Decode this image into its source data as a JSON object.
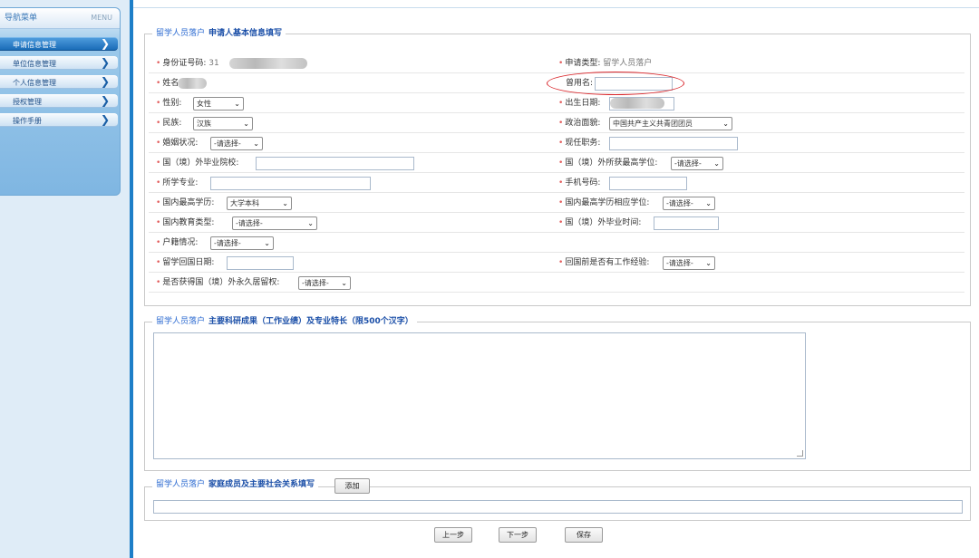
{
  "sidebar": {
    "title": "导航菜单",
    "menu_label": "MENU",
    "items": [
      {
        "label": "申请信息管理",
        "active": true
      },
      {
        "label": "单位信息管理",
        "active": false
      },
      {
        "label": "个人信息管理",
        "active": false
      },
      {
        "label": "授权管理",
        "active": false
      },
      {
        "label": "操作手册",
        "active": false
      }
    ]
  },
  "section1": {
    "lead": "留学人员落户",
    "title": "申请人基本信息填写"
  },
  "form": {
    "id_label": "身份证号码:",
    "id_value_prefix": "31",
    "apply_type_label": "申请类型:",
    "apply_type_value": "留学人员落户",
    "name_label": "姓名:",
    "former_name_label": "曾用名:",
    "gender_label": "性别:",
    "gender_value": "女性",
    "birth_label": "出生日期:",
    "ethnic_label": "民族:",
    "ethnic_value": "汉族",
    "political_label": "政治面貌:",
    "political_value": "中国共产主义共青团团员",
    "marital_label": "婚姻状况:",
    "marital_value": "-请选择-",
    "job_label": "现任职务:",
    "overseas_school_label": "国（境）外毕业院校:",
    "overseas_degree_label": "国（境）外所获最高学位:",
    "overseas_degree_value": "-请选择-",
    "major_label": "所学专业:",
    "phone_label": "手机号码:",
    "domestic_edu_label": "国内最高学历:",
    "domestic_edu_value": "大学本科",
    "domestic_degree_label": "国内最高学历相应学位:",
    "domestic_degree_value": "-请选择-",
    "domestic_edu_type_label": "国内教育类型:",
    "domestic_edu_type_value": "-请选择-",
    "overseas_grad_time_label": "国（境）外毕业时间:",
    "hukou_label": "户籍情况:",
    "hukou_value": "-请选择-",
    "return_date_label": "留学回国日期:",
    "work_exp_label": "回国前是否有工作经验:",
    "work_exp_value": "-请选择-",
    "residency_label": "是否获得国（境）外永久居留权:",
    "residency_value": "-请选择-"
  },
  "section2": {
    "lead": "留学人员落户",
    "title": "主要科研成果（工作业绩）及专业特长（限500个汉字）"
  },
  "section3": {
    "lead": "留学人员落户",
    "title": "家庭成员及主要社会关系填写",
    "add_label": "添加"
  },
  "buttons": {
    "prev": "上一步",
    "next": "下一步",
    "save": "保存"
  },
  "colors": {
    "accent": "#1e7fc8",
    "required": "#e35d5d",
    "highlight": "#d9252a"
  }
}
